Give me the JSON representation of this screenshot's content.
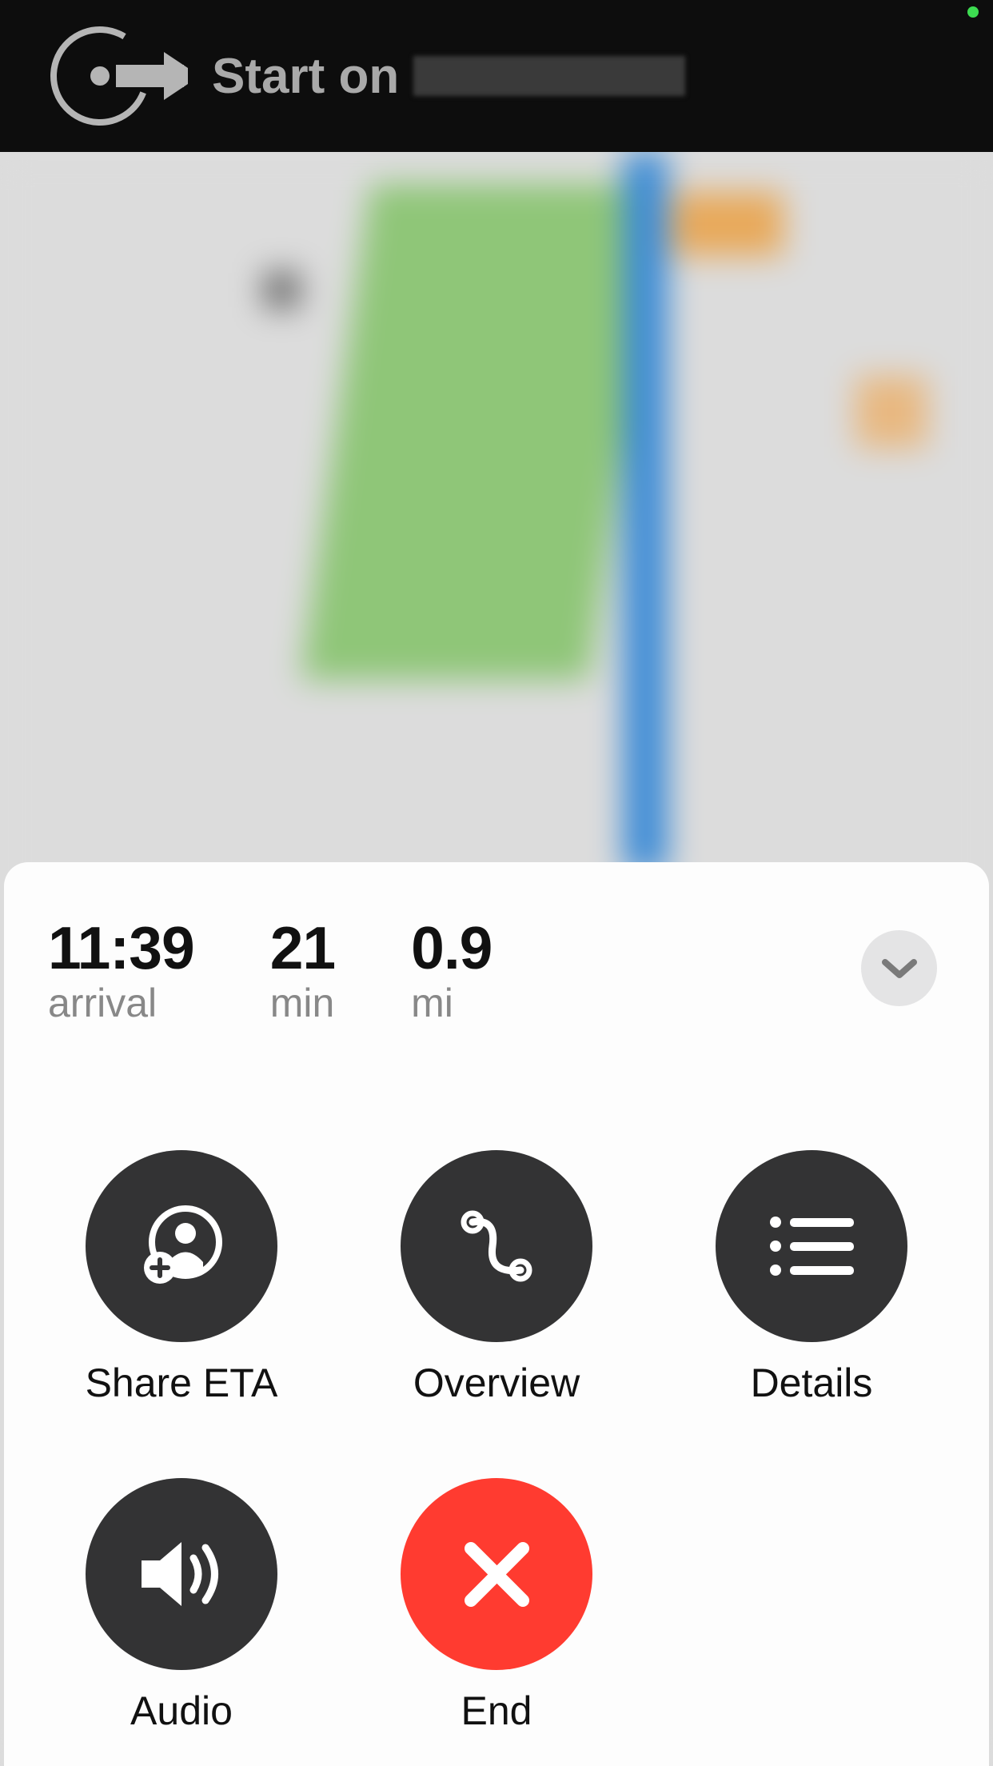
{
  "nav": {
    "instruction_prefix": "Start on"
  },
  "stats": {
    "arrival_value": "11:39",
    "arrival_label": "arrival",
    "duration_value": "21",
    "duration_label": "min",
    "distance_value": "0.9",
    "distance_label": "mi"
  },
  "actions": {
    "share_eta": "Share ETA",
    "overview": "Overview",
    "details": "Details",
    "audio": "Audio",
    "end": "End"
  }
}
